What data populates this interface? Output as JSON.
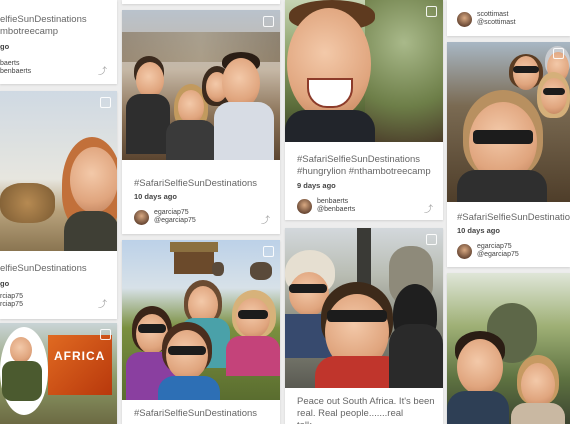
{
  "social": {
    "home": "⌂",
    "twitter": "t",
    "youtube": "▶"
  },
  "col1": {
    "card1": {
      "caption_a": "elfieSunDestinations",
      "caption_b": "mbotreecamp",
      "age": "go",
      "user_a": "baerts",
      "user_b": "benbaerts"
    },
    "card2": {
      "caption": "elfieSunDestinations",
      "age": "go",
      "user_a": "rciap75",
      "user_b": "rciap75"
    },
    "banner": {
      "text": "AFRICA"
    }
  },
  "col2": {
    "card1": {
      "caption": "#SafariSelfieSunDestinations",
      "age": "10 days ago",
      "user": "egarciap75",
      "handle": "@egarciap75"
    },
    "card2": {
      "caption": "#SafariSelfieSunDestinations"
    }
  },
  "col3": {
    "card1": {
      "caption_a": "#SafariSelfieSunDestinations",
      "caption_b": "#hungrylion #nthambotreecamp",
      "age": "9 days ago",
      "user": "benbaerts",
      "handle": "@benbaerts"
    },
    "card2": {
      "caption_a": "Peace out South Africa. It's been",
      "caption_b": "real. Real people.......real talk......"
    }
  },
  "col4": {
    "card0": {
      "user": "scottimast",
      "handle": "@scottimast"
    },
    "card1": {
      "caption": "#SafariSelfieSunDestinations",
      "age": "10 days ago",
      "user": "egarciap75",
      "handle": "@egarciap75"
    }
  }
}
